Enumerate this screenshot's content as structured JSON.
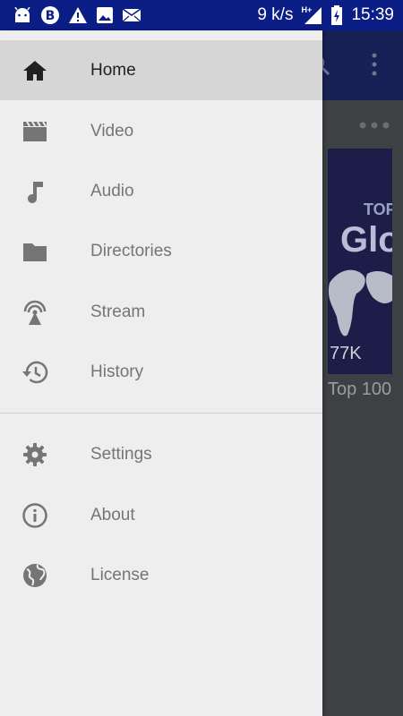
{
  "status_bar": {
    "speed": "9 k/s",
    "network": "H+",
    "time": "15:39"
  },
  "background_app": {
    "thumbnail_line1": "TOP",
    "thumbnail_line2": "Glo",
    "thumbnail_views": "77K",
    "thumbnail_title": "Top 100"
  },
  "drawer": {
    "primary_items": [
      {
        "label": "Home",
        "icon": "home-icon",
        "active": true
      },
      {
        "label": "Video",
        "icon": "video-clapper-icon"
      },
      {
        "label": "Audio",
        "icon": "music-note-icon"
      },
      {
        "label": "Directories",
        "icon": "folder-icon"
      },
      {
        "label": "Stream",
        "icon": "antenna-icon"
      },
      {
        "label": "History",
        "icon": "history-icon"
      }
    ],
    "secondary_items": [
      {
        "label": "Settings",
        "icon": "gear-icon"
      },
      {
        "label": "About",
        "icon": "info-icon"
      },
      {
        "label": "License",
        "icon": "globe-icon"
      }
    ]
  },
  "colors": {
    "status_bar": "#0b1e86",
    "drawer_bg": "#eeeeee",
    "active_item_bg": "#d6d6d6"
  }
}
